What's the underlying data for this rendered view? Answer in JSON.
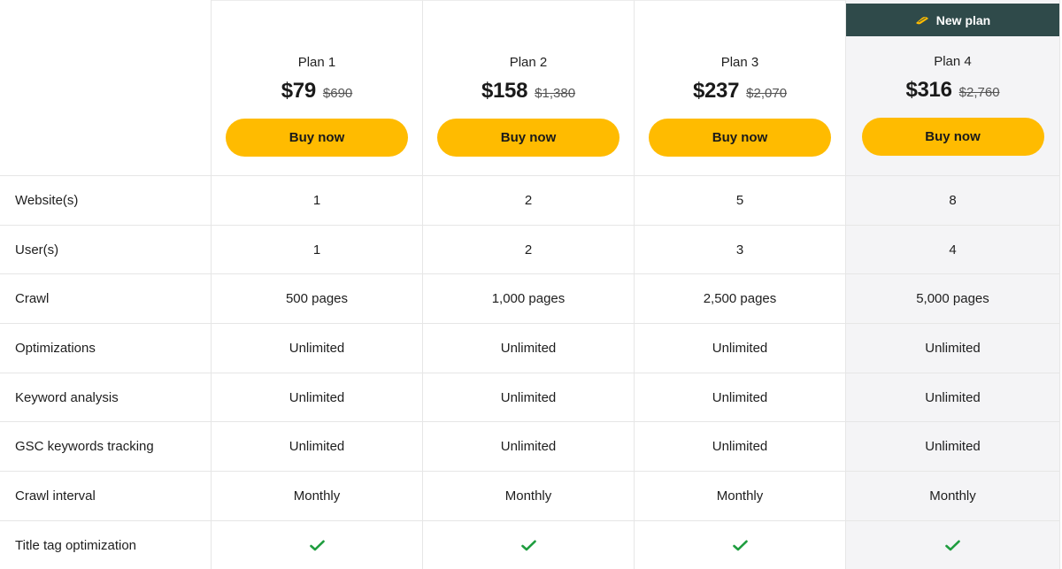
{
  "badge": {
    "label": "New plan",
    "icon": "tag-icon"
  },
  "plans": [
    {
      "name": "Plan 1",
      "price": "$79",
      "old_price": "$690",
      "button": "Buy now"
    },
    {
      "name": "Plan 2",
      "price": "$158",
      "old_price": "$1,380",
      "button": "Buy now"
    },
    {
      "name": "Plan 3",
      "price": "$237",
      "old_price": "$2,070",
      "button": "Buy now"
    },
    {
      "name": "Plan 4",
      "price": "$316",
      "old_price": "$2,760",
      "button": "Buy now"
    }
  ],
  "features": [
    {
      "label": "Website(s)",
      "values": [
        "1",
        "2",
        "5",
        "8"
      ]
    },
    {
      "label": "User(s)",
      "values": [
        "1",
        "2",
        "3",
        "4"
      ]
    },
    {
      "label": "Crawl",
      "values": [
        "500 pages",
        "1,000 pages",
        "2,500 pages",
        "5,000 pages"
      ]
    },
    {
      "label": "Optimizations",
      "values": [
        "Unlimited",
        "Unlimited",
        "Unlimited",
        "Unlimited"
      ]
    },
    {
      "label": "Keyword analysis",
      "values": [
        "Unlimited",
        "Unlimited",
        "Unlimited",
        "Unlimited"
      ]
    },
    {
      "label": "GSC keywords tracking",
      "values": [
        "Unlimited",
        "Unlimited",
        "Unlimited",
        "Unlimited"
      ]
    },
    {
      "label": "Crawl interval",
      "values": [
        "Monthly",
        "Monthly",
        "Monthly",
        "Monthly"
      ]
    },
    {
      "label": "Title tag optimization",
      "values": [
        "check",
        "check",
        "check",
        "check"
      ]
    }
  ],
  "colors": {
    "button": "#ffbb00",
    "badge_bg": "#2f4a4a",
    "highlight_bg": "#f4f4f6",
    "check": "#1f9d3f"
  }
}
